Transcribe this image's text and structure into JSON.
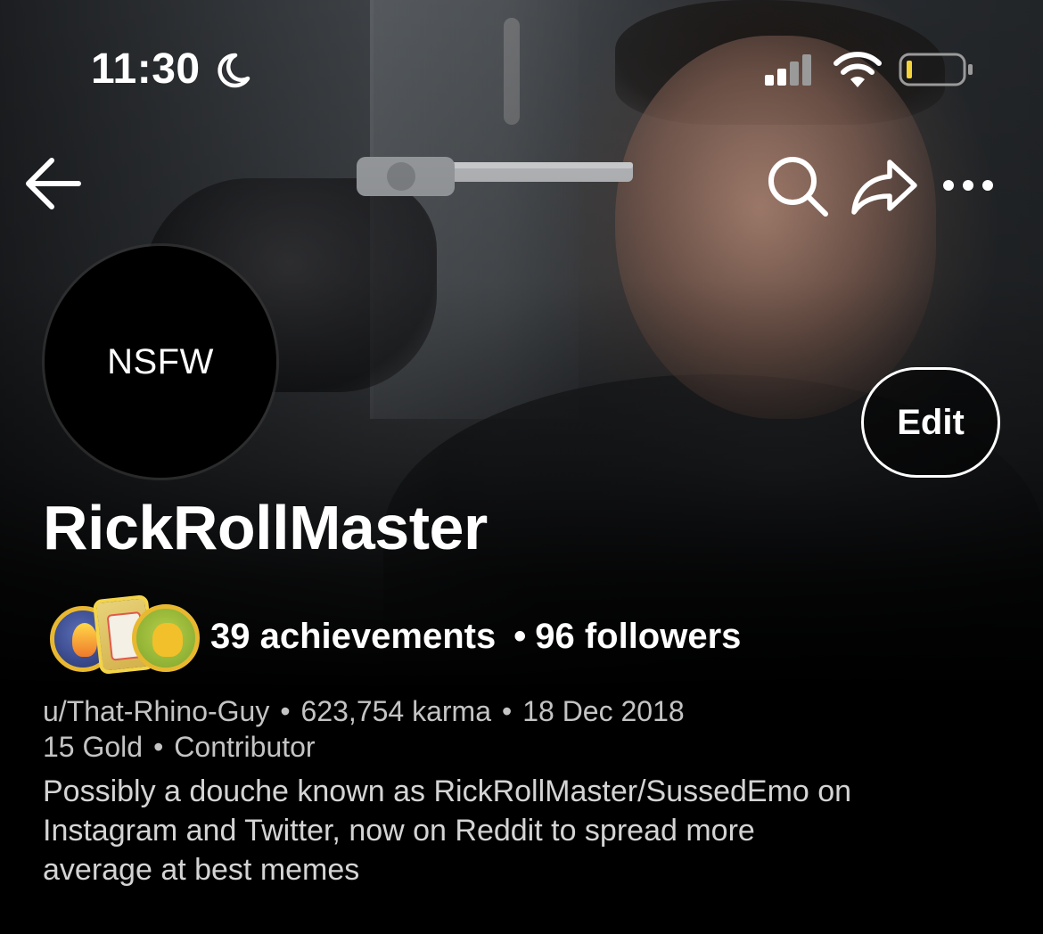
{
  "status_bar": {
    "time": "11:30",
    "icons": [
      "moon-icon",
      "signal-icon",
      "wifi-icon",
      "battery-icon"
    ]
  },
  "nav": {
    "icons": [
      "back-arrow-icon",
      "search-icon",
      "share-icon",
      "more-icon"
    ]
  },
  "avatar": {
    "label": "NSFW"
  },
  "edit_button": {
    "label": "Edit"
  },
  "profile": {
    "display_name": "RickRollMaster",
    "achievements": "39 achievements",
    "followers": "96 followers",
    "separator": "•",
    "username": "u/That-Rhino-Guy",
    "karma": "623,754 karma",
    "joined": "18 Dec 2018",
    "gold": "15 Gold",
    "role": "Contributor",
    "bio": "Possibly a douche known as RickRollMaster/SussedEmo on\nInstagram and Twitter, now on Reddit to spread more\naverage at best memes"
  },
  "badges": [
    "rocket-achievement-badge",
    "card-achievement-badge",
    "dog-achievement-badge"
  ],
  "colors": {
    "background": "#000000",
    "text_primary": "#ffffff",
    "text_secondary": "#c4c4c4",
    "badge_gold": "#e8b830",
    "battery_low": "#f5d33a"
  }
}
